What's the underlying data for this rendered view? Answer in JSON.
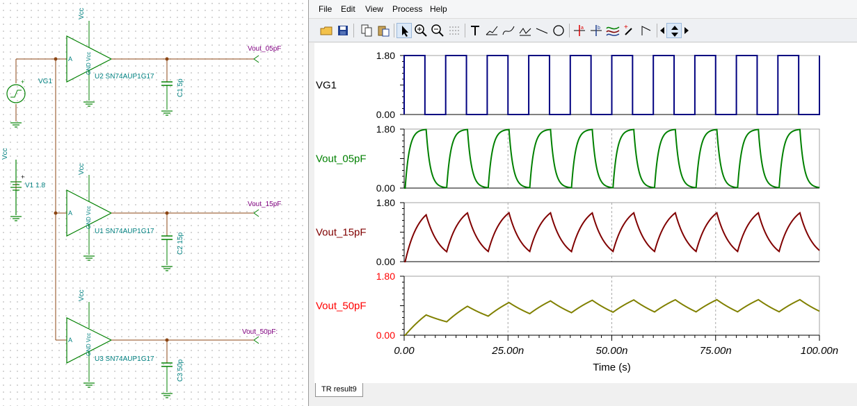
{
  "schematic": {
    "components": [
      {
        "ref": "U2 SN74AUP1G17",
        "cap": "C1 5p",
        "out": "Vout_05pF"
      },
      {
        "ref": "U1 SN74AUP1G17",
        "cap": "C2 15p",
        "out": "Vout_15pF"
      },
      {
        "ref": "U3 SN74AUP1G17",
        "cap": "C3 50p",
        "out": "Vout_50pF:"
      }
    ],
    "vcc": "Vcc",
    "gnd_vcc": "GND Vcc",
    "pin_a": "A",
    "vg1": "VG1",
    "v1": "V1 1.8",
    "plus": "+"
  },
  "menu": [
    "File",
    "Edit",
    "View",
    "Process",
    "Help"
  ],
  "toolbar": [
    "open-icon",
    "save-icon",
    "copy-icon",
    "paste-icon",
    "pointer-icon",
    "zoom-in-icon",
    "zoom-out-icon",
    "grid-icon",
    "text-icon",
    "curve-label-icon",
    "curve-label2-icon",
    "curve-label3-icon",
    "line-icon",
    "ellipse-icon",
    "cursor-a-icon",
    "cursor-b-icon",
    "waveform-icon",
    "probe-icon",
    "marker-icon",
    "scroll-left-icon",
    "scroll-updown-icon",
    "scroll-right-icon"
  ],
  "status": {
    "tab": "TR result9"
  },
  "chart_data": {
    "type": "line",
    "xlabel": "Time (s)",
    "xlim": [
      0,
      100
    ],
    "x_ticks": [
      "0.00",
      "25.00n",
      "50.00n",
      "75.00n",
      "100.00n"
    ],
    "x_tick_values": [
      0,
      25,
      50,
      75,
      100
    ],
    "ylim": [
      0,
      1.8
    ],
    "y_ticks": [
      "0.00",
      "1.80"
    ],
    "panels": [
      {
        "name": "VG1",
        "color": "#000080",
        "label_color": "#000000",
        "tick_color": "#000000",
        "shape": "square",
        "period": 10,
        "high_start": 0,
        "high_end": 5,
        "max": 1.8,
        "min": 0
      },
      {
        "name": "Vout_05pF",
        "color": "#008000",
        "label_color": "#008000",
        "tick_color": "#000000",
        "shape": "rc",
        "tau": 1.0,
        "delay": 0.3
      },
      {
        "name": "Vout_15pF",
        "color": "#800000",
        "label_color": "#800000",
        "tick_color": "#000000",
        "shape": "rc",
        "tau": 3.2,
        "delay": 0.3
      },
      {
        "name": "Vout_50pF",
        "color": "#808000",
        "label_color": "#ff0000",
        "tick_color": "#ff0000",
        "shape": "rc",
        "tau": 12.0,
        "delay": 0.3
      }
    ]
  }
}
